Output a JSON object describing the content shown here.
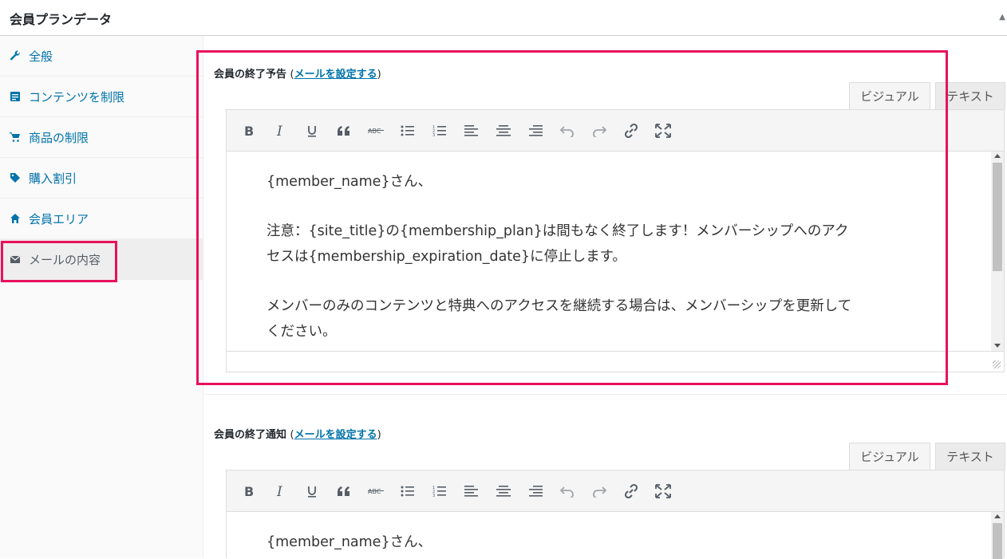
{
  "header": {
    "title": "会員プランデータ"
  },
  "sidebar": {
    "items": [
      {
        "label": "全般",
        "icon": "wrench-icon"
      },
      {
        "label": "コンテンツを制限",
        "icon": "document-icon"
      },
      {
        "label": "商品の制限",
        "icon": "cart-icon"
      },
      {
        "label": "購入割引",
        "icon": "tag-icon"
      },
      {
        "label": "会員エリア",
        "icon": "home-icon"
      },
      {
        "label": "メールの内容",
        "icon": "email-icon",
        "active": true
      }
    ]
  },
  "sections": [
    {
      "label": "会員の終了予告",
      "paren_open": "(",
      "link": "メールを設定する",
      "paren_close": ")",
      "tabs": {
        "visual": "ビジュアル",
        "text": "テキスト"
      },
      "body": {
        "line1": "{member_name}さん、",
        "line2": "注意：{site_title}の{membership_plan}は間もなく終了します！メンバーシップへのアクセスは{membership_expiration_date}に停止します。",
        "line3": "メンバーのみのコンテンツと特典へのアクセスを継続する場合は、メンバーシップを更新してください。"
      }
    },
    {
      "label": "会員の終了通知",
      "paren_open": "(",
      "link": "メールを設定する",
      "paren_close": ")",
      "tabs": {
        "visual": "ビジュアル",
        "text": "テキスト"
      },
      "body": {
        "line1": "{member_name}さん、"
      }
    }
  ],
  "colors": {
    "highlight": "#e8115b",
    "link": "#0073aa"
  }
}
